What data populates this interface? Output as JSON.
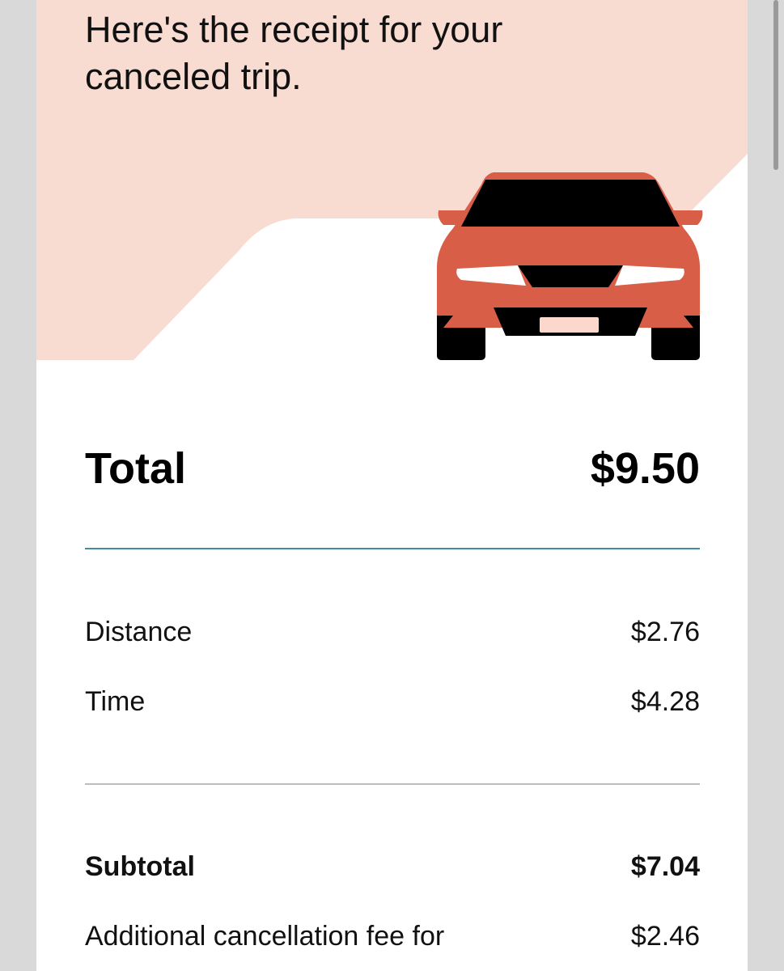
{
  "header": {
    "headline": "Here's the receipt for your canceled trip."
  },
  "illustration": {
    "icon": "car-icon",
    "colors": {
      "body": "#d95e48",
      "dark": "#000000",
      "background": "#f8dbd1",
      "headlights": "#ffffff",
      "plate": "#fbd7cc"
    }
  },
  "total": {
    "label": "Total",
    "amount": "$9.50"
  },
  "breakdown": {
    "distance": {
      "label": "Distance",
      "amount": "$2.76"
    },
    "time": {
      "label": "Time",
      "amount": "$4.28"
    }
  },
  "subtotal": {
    "label": "Subtotal",
    "amount": "$7.04"
  },
  "cancellation_fee": {
    "label": "Additional cancellation fee for",
    "amount": "$2.46"
  },
  "colors": {
    "accent_divider": "#3e8fa0",
    "divider": "#bdbdbd",
    "hero": "#f8dbd1"
  }
}
